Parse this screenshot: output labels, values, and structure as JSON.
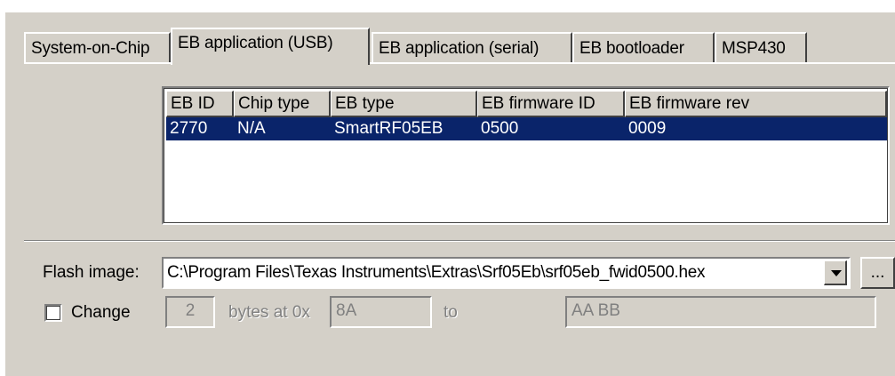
{
  "tabs": [
    {
      "label": "System-on-Chip",
      "active": false
    },
    {
      "label": "EB application (USB)",
      "active": true
    },
    {
      "label": "EB application (serial)",
      "active": false
    },
    {
      "label": "EB bootloader",
      "active": false
    },
    {
      "label": "MSP430",
      "active": false
    }
  ],
  "device_list": {
    "columns": [
      "EB ID",
      "Chip type",
      "EB type",
      "EB firmware ID",
      "EB firmware rev"
    ],
    "rows": [
      {
        "eb_id": "2770",
        "chip_type": "N/A",
        "eb_type": "SmartRF05EB",
        "fw_id": "0500",
        "fw_rev": "0009",
        "selected": true
      }
    ]
  },
  "flash_image": {
    "label": "Flash image:",
    "value": "C:\\Program Files\\Texas Instruments\\Extras\\Srf05Eb\\srf05eb_fwid0500.hex",
    "browse_label": "..."
  },
  "change": {
    "label": "Change",
    "checked": false,
    "byte_count": "2",
    "bytes_at_label": "bytes at 0x",
    "address": "8A",
    "to_label": "to",
    "bytes_value": "AA BB"
  },
  "colors": {
    "face": "#d4d0c8",
    "selection": "#0a246a"
  }
}
